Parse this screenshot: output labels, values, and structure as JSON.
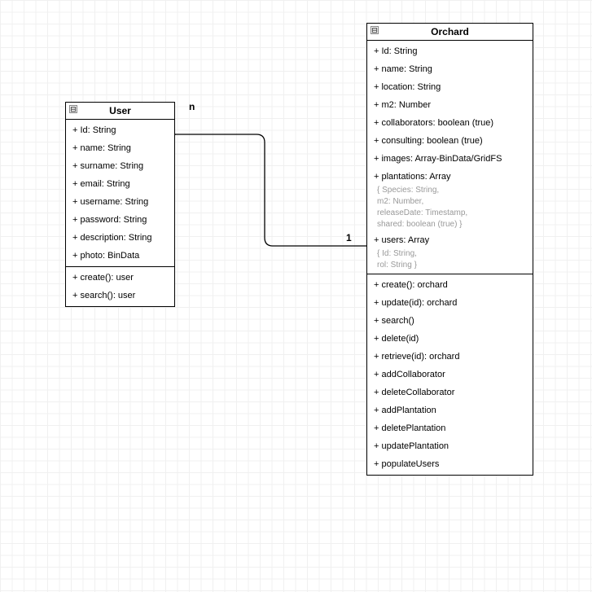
{
  "classes": {
    "user": {
      "title": "User",
      "attributes": [
        "+ Id: String",
        "+ name: String",
        "+ surname: String",
        "+ email: String",
        "+ username: String",
        "+ password: String",
        "+ description: String",
        "+ photo: BinData"
      ],
      "methods": [
        "+ create(): user",
        "+ search(): user"
      ]
    },
    "orchard": {
      "title": "Orchard",
      "attributes": [
        {
          "text": "+ Id: String"
        },
        {
          "text": "+ name: String"
        },
        {
          "text": "+ location: String"
        },
        {
          "text": "+ m2: Number"
        },
        {
          "text": "+ collaborators: boolean (true)"
        },
        {
          "text": "+ consulting: boolean (true)"
        },
        {
          "text": "+ images: Array-BinData/GridFS"
        },
        {
          "text": "+ plantations: Array",
          "sub": [
            "{ Species: String,",
            "m2: Number,",
            "releaseDate: Timestamp,",
            "shared: boolean (true) }"
          ]
        },
        {
          "text": "+ users: Array",
          "sub": [
            "{ Id: String,",
            "rol: String }"
          ]
        }
      ],
      "methods": [
        "+ create(): orchard",
        "+ update(id): orchard",
        "+ search()",
        "+ delete(id)",
        "+ retrieve(id): orchard",
        "+ addCollaborator",
        "+ deleteCollaborator",
        "+ addPlantation",
        "+ deletePlantation",
        "+ updatePlantation",
        "+ populateUsers"
      ]
    }
  },
  "relationship": {
    "from_mult": "n",
    "to_mult": "1"
  },
  "collapse_glyph": "⊟"
}
